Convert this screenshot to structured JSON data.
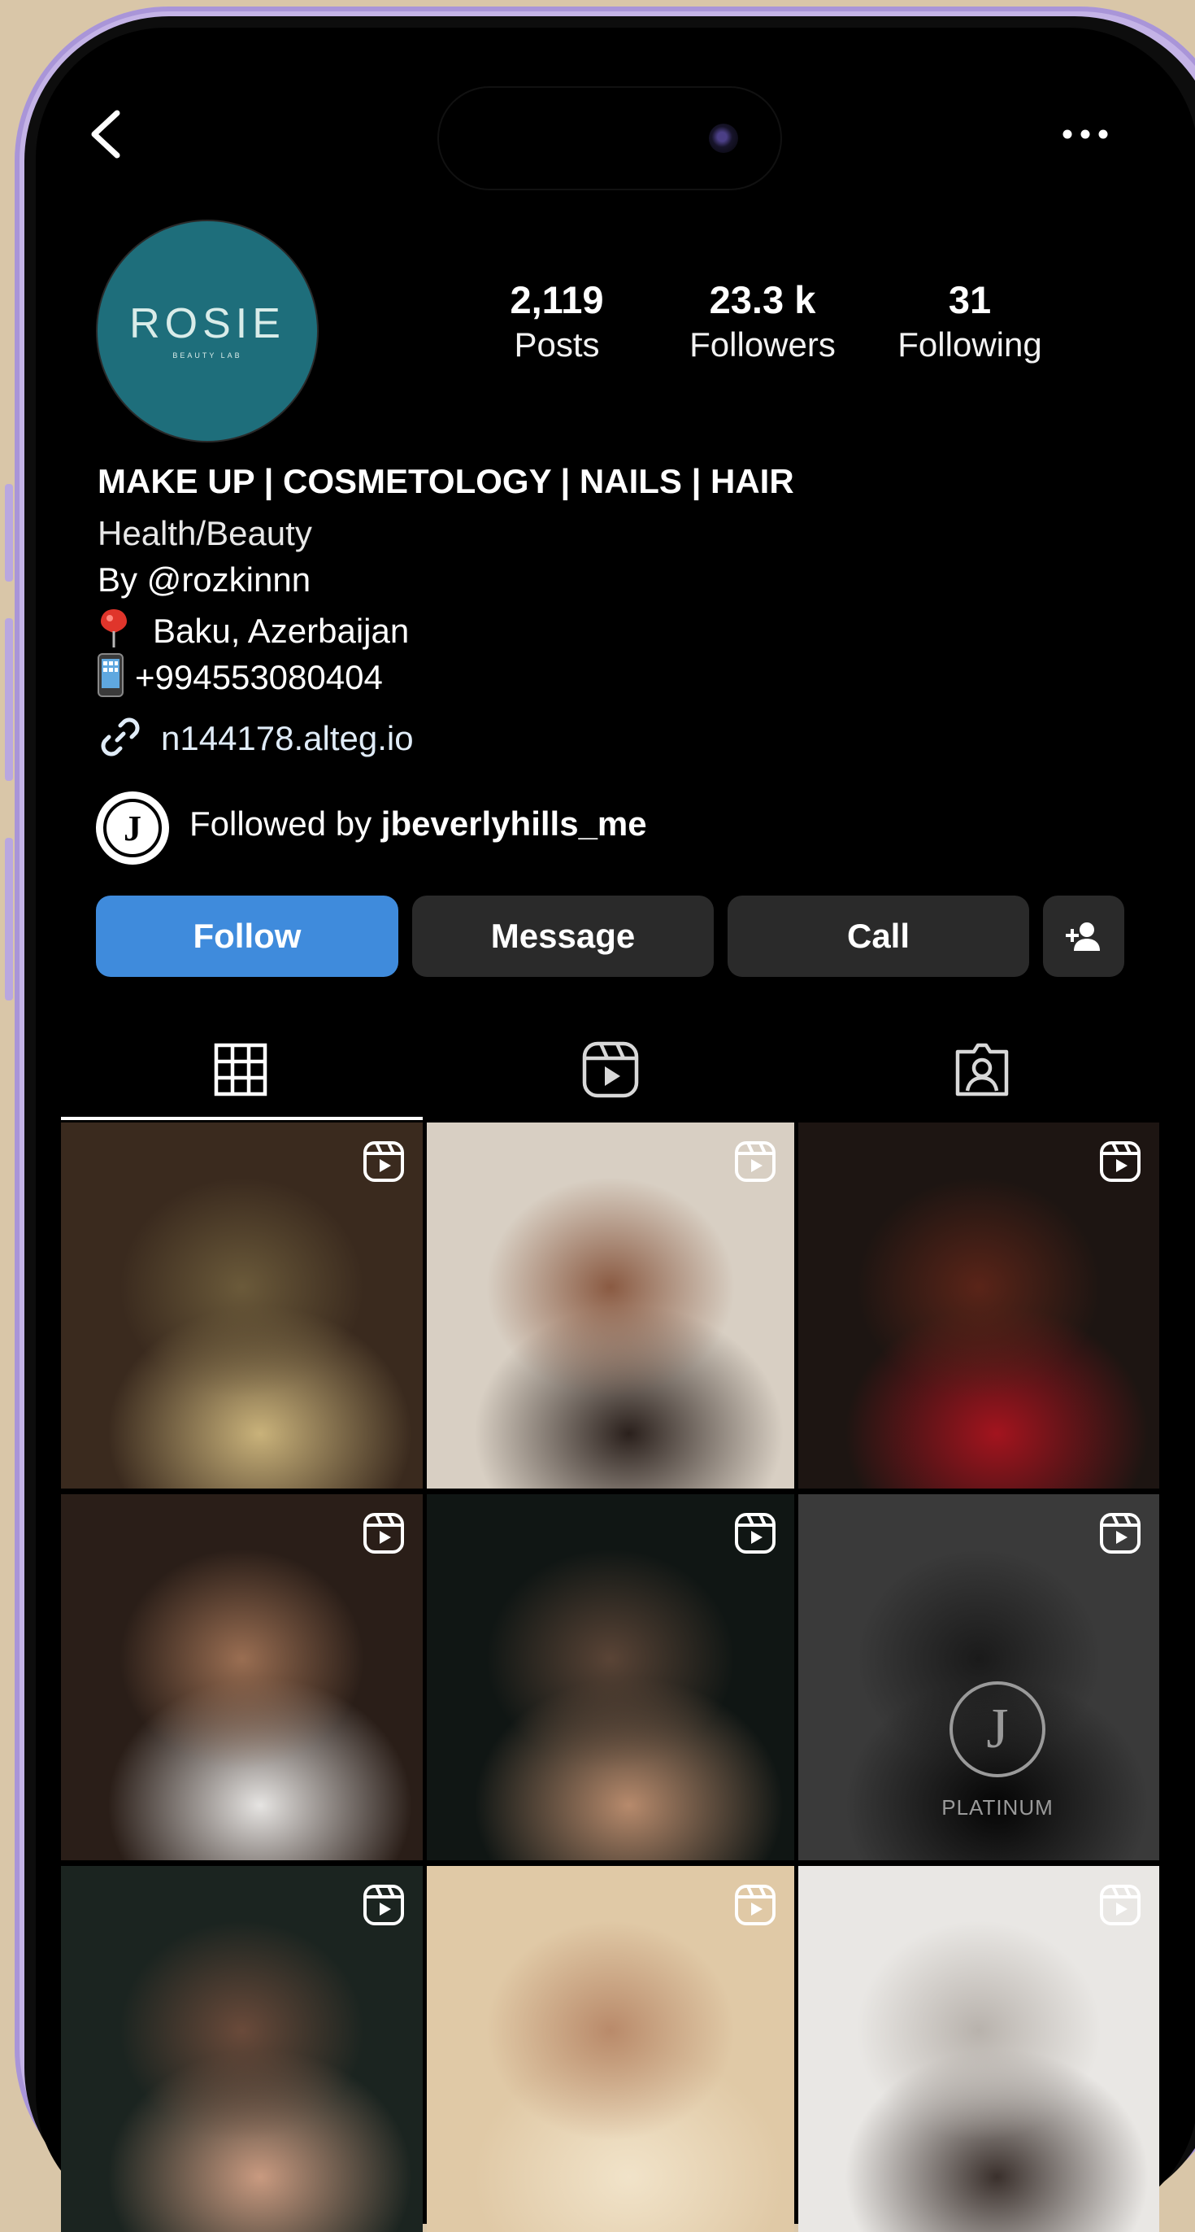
{
  "profile": {
    "avatar_brand": "ROSIE",
    "avatar_sub": "BEAUTY LAB",
    "stats": [
      {
        "value": "2,119",
        "label": "Posts"
      },
      {
        "value": "23.3 k",
        "label": "Followers"
      },
      {
        "value": "31",
        "label": "Following"
      }
    ],
    "bio_title": "MAKE UP | COSMETOLOGY | NAILS | HAIR",
    "category": "Health/Beauty",
    "by": "By @rozkinnn",
    "location": "Baku, Azerbaijan",
    "phone": "+994553080404",
    "link": "n144178.alteg.io",
    "followed_by_prefix": "Followed by ",
    "followed_by_user": "jbeverlyhills_me",
    "followed_by_avatar_letter": "J"
  },
  "actions": {
    "follow": "Follow",
    "message": "Message",
    "call": "Call"
  },
  "grid": {
    "tiles": [
      {
        "name": "tile-champagne-glasses",
        "colors": [
          "#3a2a1e",
          "#6b5a3a",
          "#c9b27a"
        ]
      },
      {
        "name": "tile-model-curlers",
        "colors": [
          "#d8cfc3",
          "#8a5a42",
          "#2a201c"
        ]
      },
      {
        "name": "tile-red-nails",
        "colors": [
          "#1d1512",
          "#5a2418",
          "#a3141e"
        ]
      },
      {
        "name": "tile-model-white-robe",
        "colors": [
          "#2a1e18",
          "#9a6e52",
          "#e6e4e2"
        ]
      },
      {
        "name": "tile-model-closeup",
        "colors": [
          "#101614",
          "#5a4436",
          "#b78a6c"
        ]
      },
      {
        "name": "tile-j-platinum-bottle",
        "colors": [
          "#3a3a3a",
          "#1a1a1a",
          "#050505"
        ]
      },
      {
        "name": "tile-model-hair-up",
        "colors": [
          "#1b2420",
          "#6a4a3a",
          "#c99a80"
        ]
      },
      {
        "name": "tile-blonde-makeup",
        "colors": [
          "#e0c9a6",
          "#b98a6a",
          "#f1e3c9"
        ]
      },
      {
        "name": "tile-bride-veil",
        "colors": [
          "#e9e7e4",
          "#b8b2ac",
          "#3a302c"
        ]
      }
    ],
    "bottle_text": "PLATINUM",
    "bottle_logo": "J"
  },
  "colors": {
    "accent": "#3f8bdc",
    "button_secondary": "#2a2a2a",
    "avatar_bg": "#1e6e7b"
  }
}
